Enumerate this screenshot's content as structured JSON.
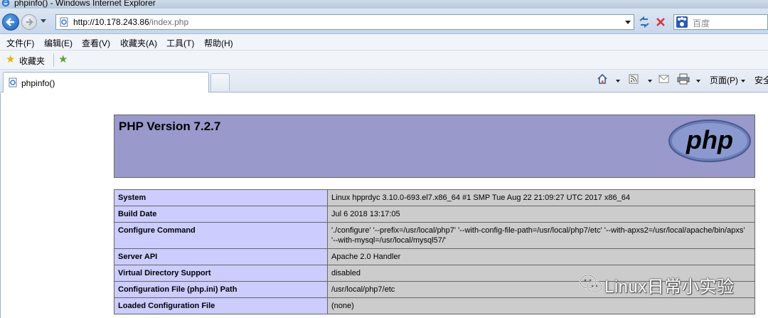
{
  "window": {
    "title": "phpinfo() - Windows Internet Explorer"
  },
  "address": {
    "url_host": "http://10.178.243.86",
    "url_path": "/index.php"
  },
  "search": {
    "placeholder": "百度"
  },
  "menu": {
    "items": [
      "文件(F)",
      "编辑(E)",
      "查看(V)",
      "收藏夹(A)",
      "工具(T)",
      "帮助(H)"
    ]
  },
  "favorites": {
    "label": "收藏夹"
  },
  "tab": {
    "title": "phpinfo()"
  },
  "toolbar": {
    "page_label": "页面(P)",
    "safety_label": "安全"
  },
  "php": {
    "version": "PHP Version 7.2.7",
    "logo_text": "php",
    "rows": [
      {
        "key": "System",
        "value": "Linux hpprdyc 3.10.0-693.el7.x86_64 #1 SMP Tue Aug 22 21:09:27 UTC 2017 x86_64"
      },
      {
        "key": "Build Date",
        "value": "Jul 6 2018 13:17:05"
      },
      {
        "key": "Configure Command",
        "value": "'./configure' '--prefix=/usr/local/php7' '--with-config-file-path=/usr/local/php7/etc' '--with-apxs2=/usr/local/apache/bin/apxs' '--with-mysql=/usr/local/mysql57/'"
      },
      {
        "key": "Server API",
        "value": "Apache 2.0 Handler"
      },
      {
        "key": "Virtual Directory Support",
        "value": "disabled"
      },
      {
        "key": "Configuration File (php.ini) Path",
        "value": "/usr/local/php7/etc"
      },
      {
        "key": "Loaded Configuration File",
        "value": "(none)"
      }
    ]
  },
  "watermark": {
    "text": "Linux日常小实验"
  }
}
